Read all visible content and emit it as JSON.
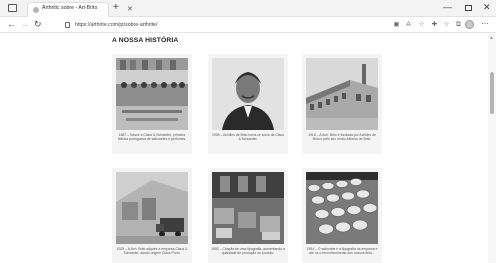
{
  "browser": {
    "tab_title": "Arthritic sobre - Art-Brito",
    "url": "https://arthrite.com/pt/sobre-arthrite/",
    "icons": {
      "tab_switch": "tab-actions-icon",
      "tab_close": "close-icon",
      "new_tab": "plus-icon",
      "back": "arrow-left-icon",
      "forward": "arrow-right-icon",
      "reload": "reload-icon",
      "lock": "lock-icon",
      "toolbar": [
        "apps-icon",
        "read-aloud-icon",
        "star-icon",
        "extensions-icon",
        "favorites-icon",
        "collections-icon",
        "profile-icon",
        "more-icon"
      ]
    },
    "glyphs": {
      "close": "✕",
      "new_tab": "+",
      "back": "←",
      "forward": "→",
      "reload": "↻",
      "minimize": "—",
      "win_close": "✕",
      "menu": "⋯",
      "scroll_up": "▲"
    }
  },
  "page": {
    "heading": "A NOSSA HISTÓRIA",
    "cards": [
      {
        "caption": "1887 – Nasce a Claus & Schweder, primeira fábrica portuguesa de sabonetes e perfumes.",
        "photo": "factory-workers-photo"
      },
      {
        "caption": "1908 – Achilles de Brito torna-se sócio da Claus & Schweder.",
        "photo": "portrait-photo"
      },
      {
        "caption": "1918 – A Ach. Brito é fundada por Achilles de Brito e pelo seu irmão Affonso de Brito.",
        "photo": "factory-building-photo"
      },
      {
        "caption": "1925 – A Ach. Brito adquire a empresa Claus & Schweder, dando origem Claus Porto.",
        "photo": "warehouse-truck-photo"
      },
      {
        "caption": "1950 – Criação de uma tipografia, aumentando a qualidade de produção do produto.",
        "photo": "printing-room-photo"
      },
      {
        "caption": "1994 – O sabonete e a tipografia da empresa e até os o reconhecimento dos nossos feito...",
        "photo": "soap-bars-photo"
      }
    ]
  },
  "colors": {
    "heading": "#222222",
    "card_bg": "#f4f4f4",
    "caption": "#555555"
  }
}
